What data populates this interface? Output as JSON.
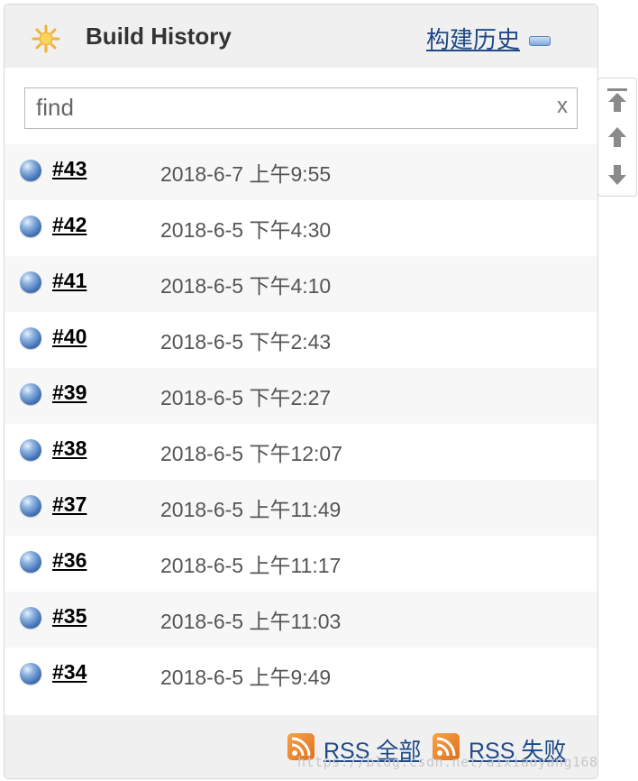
{
  "header": {
    "title": "Build History",
    "cn_title": "构建历史",
    "icons": {
      "weather": "sun-icon",
      "collapse": "minus-icon"
    }
  },
  "search": {
    "placeholder": "find",
    "value": "",
    "clear_label": "x"
  },
  "builds": [
    {
      "number": "#43",
      "time": "2018-6-7 上午9:55",
      "status": "success"
    },
    {
      "number": "#42",
      "time": "2018-6-5 下午4:30",
      "status": "success"
    },
    {
      "number": "#41",
      "time": "2018-6-5 下午4:10",
      "status": "success"
    },
    {
      "number": "#40",
      "time": "2018-6-5 下午2:43",
      "status": "success"
    },
    {
      "number": "#39",
      "time": "2018-6-5 下午2:27",
      "status": "success"
    },
    {
      "number": "#38",
      "time": "2018-6-5 下午12:07",
      "status": "success"
    },
    {
      "number": "#37",
      "time": "2018-6-5 上午11:49",
      "status": "success"
    },
    {
      "number": "#36",
      "time": "2018-6-5 上午11:17",
      "status": "success"
    },
    {
      "number": "#35",
      "time": "2018-6-5 上午11:03",
      "status": "success"
    },
    {
      "number": "#34",
      "time": "2018-6-5 上午9:49",
      "status": "success"
    }
  ],
  "footer": {
    "rss_all": "RSS 全部",
    "rss_failed": "RSS 失败"
  },
  "nav": {
    "icons": [
      "arrow-to-top-icon",
      "arrow-up-icon",
      "arrow-down-icon"
    ]
  },
  "watermark": "https://blog.csdn.net/aixiaoyang168",
  "colors": {
    "link": "#204a87",
    "status_blue": "#3f6fb3",
    "rss_orange": "#e0701b",
    "header_bg": "#f0f0f0"
  }
}
